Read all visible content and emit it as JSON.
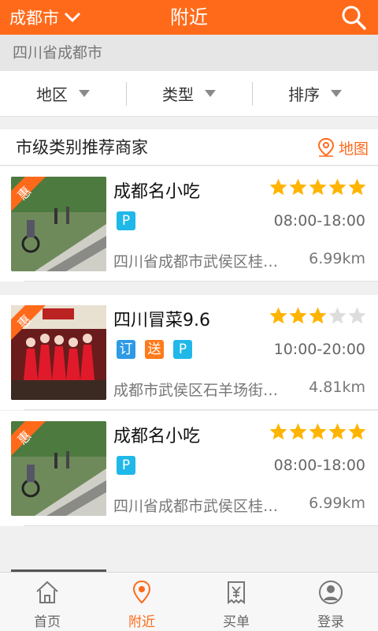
{
  "header": {
    "city": "成都市",
    "title": "附近"
  },
  "location": "四川省成都市",
  "filters": [
    {
      "label": "地区"
    },
    {
      "label": "类型"
    },
    {
      "label": "排序"
    }
  ],
  "section": {
    "title": "市级类别推荐商家",
    "map_label": "地图"
  },
  "merchants": [
    {
      "name": "成都名小吃",
      "badge": "惠",
      "rating": 5,
      "tags": [
        {
          "text": "P",
          "color": "#1fb8e8"
        }
      ],
      "hours": "08:00-18:00",
      "address": "四川省成都市武侯区桂…",
      "distance": "6.99km"
    },
    {
      "name": "四川冒菜9.6",
      "badge": "惠",
      "rating": 3,
      "tags": [
        {
          "text": "订",
          "color": "#2e9ae6"
        },
        {
          "text": "送",
          "color": "#ff7a1a"
        },
        {
          "text": "P",
          "color": "#1fb8e8"
        }
      ],
      "hours": "10:00-20:00",
      "address": "成都市武侯区石羊场街…",
      "distance": "4.81km"
    },
    {
      "name": "成都名小吃",
      "badge": "惠",
      "rating": 5,
      "tags": [
        {
          "text": "P",
          "color": "#1fb8e8"
        }
      ],
      "hours": "08:00-18:00",
      "address": "四川省成都市武侯区桂…",
      "distance": "6.99km"
    }
  ],
  "tabbar": {
    "tabs": [
      {
        "label": "首页",
        "icon": "home-icon"
      },
      {
        "label": "附近",
        "icon": "location-pin-icon",
        "active": true
      },
      {
        "label": "买单",
        "icon": "receipt-yen-icon"
      },
      {
        "label": "登录",
        "icon": "user-icon"
      }
    ]
  },
  "colors": {
    "accent": "#ff6a1a",
    "star_on": "#ffb400",
    "star_off": "#dddddd"
  }
}
